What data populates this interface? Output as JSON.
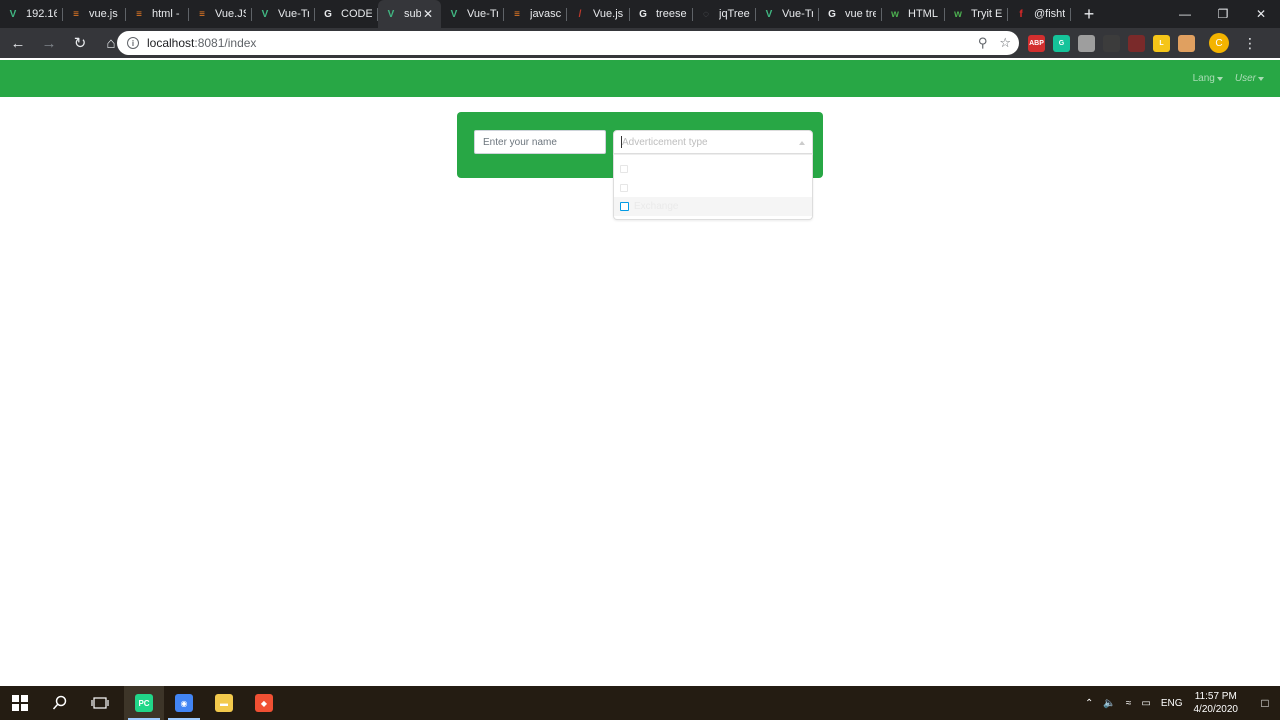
{
  "browser": {
    "tabs": [
      {
        "title": "192.16",
        "favicon": "vue-icon",
        "color": "#41b883",
        "glyph": "V"
      },
      {
        "title": "vue.js",
        "favicon": "stackoverflow-icon",
        "color": "#f48024",
        "glyph": "≡"
      },
      {
        "title": "html -",
        "favicon": "stackoverflow-icon",
        "color": "#f48024",
        "glyph": "≡"
      },
      {
        "title": "Vue.JS",
        "favicon": "stackoverflow-icon",
        "color": "#f48024",
        "glyph": "≡"
      },
      {
        "title": "Vue-Tr",
        "favicon": "vue-icon",
        "color": "#41b883",
        "glyph": "V"
      },
      {
        "title": "CODE",
        "favicon": "google-icon",
        "color": "#e8eaed",
        "glyph": "G"
      },
      {
        "title": "sub",
        "favicon": "vue-icon",
        "color": "#41b883",
        "glyph": "V",
        "active": true
      },
      {
        "title": "Vue-Tr",
        "favicon": "vue-icon",
        "color": "#41b883",
        "glyph": "V"
      },
      {
        "title": "javascr",
        "favicon": "stackoverflow-icon",
        "color": "#f48024",
        "glyph": "≡"
      },
      {
        "title": "Vue.js",
        "favicon": "laracasts-icon",
        "color": "#c0392b",
        "glyph": "/"
      },
      {
        "title": "treesel",
        "favicon": "google-icon",
        "color": "#e8eaed",
        "glyph": "G"
      },
      {
        "title": "jqTree",
        "favicon": "globe-icon",
        "color": "#5f6368",
        "glyph": "◌"
      },
      {
        "title": "Vue-Tr",
        "favicon": "vue-icon",
        "color": "#41b883",
        "glyph": "V"
      },
      {
        "title": "vue tre",
        "favicon": "google-icon",
        "color": "#e8eaed",
        "glyph": "G"
      },
      {
        "title": "HTML",
        "favicon": "w3schools-icon",
        "color": "#4caf50",
        "glyph": "w"
      },
      {
        "title": "Tryit E",
        "favicon": "w3schools-icon",
        "color": "#4caf50",
        "glyph": "w"
      },
      {
        "title": "@fisht",
        "favicon": "flipboard-icon",
        "color": "#e12828",
        "glyph": "f"
      }
    ],
    "new_tab": "+",
    "url_host": "localhost",
    "url_path": ":8081/index",
    "avatar_letter": "C",
    "extensions": [
      {
        "name": "adblock-icon",
        "color": "#d32f2f",
        "label": "ABP"
      },
      {
        "name": "grammarly-icon",
        "color": "#15c39a",
        "label": "G"
      },
      {
        "name": "extension-puzzle-icon",
        "color": "#9e9e9e",
        "label": ""
      },
      {
        "name": "extension-dark-icon",
        "color": "#3c3c3c",
        "label": ""
      },
      {
        "name": "extension-red-circle-icon",
        "color": "#7a2a2a",
        "label": ""
      },
      {
        "name": "extension-l-icon",
        "color": "#f5c518",
        "label": "L"
      },
      {
        "name": "extension-face-icon",
        "color": "#e0a060",
        "label": ""
      }
    ]
  },
  "navbar": {
    "color": "#28a745",
    "lang_label": "Lang",
    "user_label": "User"
  },
  "form": {
    "name_placeholder": "Enter your name",
    "select_placeholder": "Adverticement type",
    "options": [
      {
        "label": "",
        "hover": false
      },
      {
        "label": "",
        "hover": false
      },
      {
        "label": "Exchange",
        "hover": true
      }
    ]
  },
  "taskbar": {
    "apps": [
      {
        "name": "pycharm-icon",
        "color": "#21d789",
        "glyph": "PC",
        "open": true,
        "active": true
      },
      {
        "name": "chrome-icon",
        "color": "#4285f4",
        "glyph": "◉",
        "open": true,
        "active": false
      },
      {
        "name": "file-explorer-icon",
        "color": "#f2c94c",
        "glyph": "▬",
        "open": false,
        "active": false
      },
      {
        "name": "git-icon",
        "color": "#f05033",
        "glyph": "◆",
        "open": false,
        "active": false
      }
    ],
    "language": "ENG",
    "time": "11:57 PM",
    "date": "4/20/2020"
  }
}
